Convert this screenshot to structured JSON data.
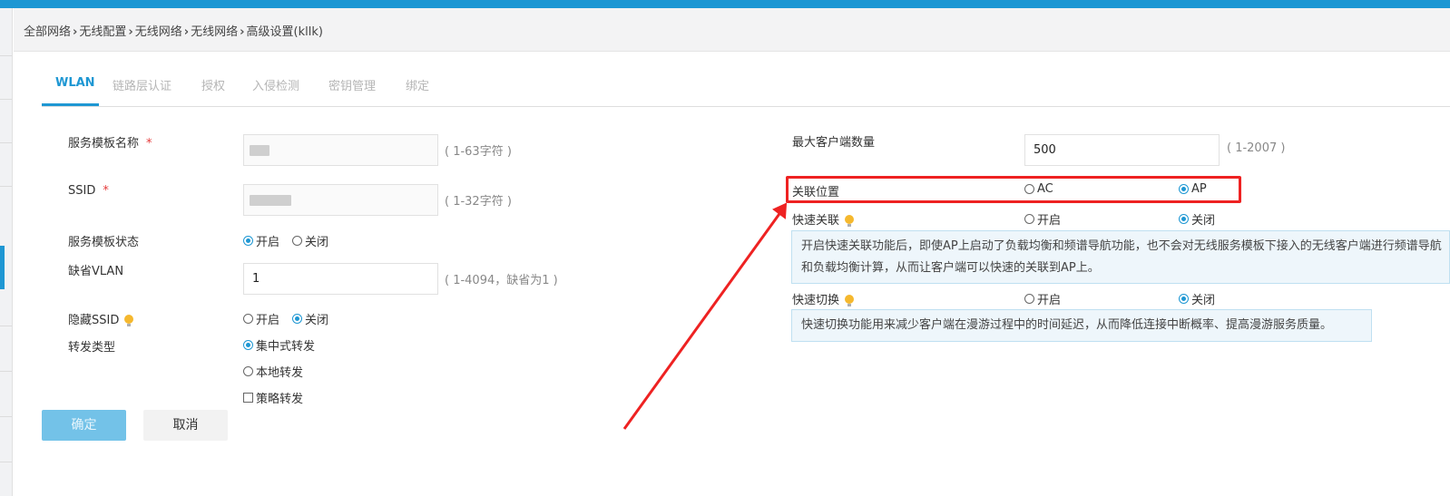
{
  "breadcrumb": [
    "全部网络",
    "无线配置",
    "无线网络",
    "无线网络",
    "高级设置(kllk)"
  ],
  "tabs": [
    "WLAN",
    "链路层认证",
    "授权",
    "入侵检测",
    "密钥管理",
    "绑定"
  ],
  "left": {
    "template_name": {
      "label": "服务模板名称",
      "required": "*",
      "hint": "( 1-63字符 )"
    },
    "ssid": {
      "label": "SSID",
      "required": "*",
      "hint": "( 1-32字符 )"
    },
    "template_status": {
      "label": "服务模板状态",
      "on": "开启",
      "off": "关闭",
      "selected": "开启"
    },
    "default_vlan": {
      "label": "缺省VLAN",
      "value": "1",
      "hint": "( 1-4094，缺省为1 )"
    },
    "hide_ssid": {
      "label": "隐藏SSID",
      "on": "开启",
      "off": "关闭",
      "selected": "关闭"
    },
    "forward_type": {
      "label": "转发类型",
      "options": [
        "集中式转发",
        "本地转发",
        "策略转发"
      ],
      "selected": "集中式转发"
    }
  },
  "right": {
    "max_clients": {
      "label": "最大客户端数量",
      "value": "500",
      "hint": "( 1-2007 )"
    },
    "assoc_location": {
      "label": "关联位置",
      "ac": "AC",
      "ap": "AP",
      "selected": "AP"
    },
    "fast_assoc": {
      "label": "快速关联",
      "on": "开启",
      "off": "关闭",
      "selected": "关闭",
      "info_line1": "开启快速关联功能后，即使AP上启动了负载均衡和频谱导航功能，也不会对无线服务模板下接入的无线客户端进行频谱导航",
      "info_line2": "和负载均衡计算，从而让客户端可以快速的关联到AP上。"
    },
    "fast_roam": {
      "label": "快速切换",
      "on": "开启",
      "off": "关闭",
      "selected": "关闭",
      "info": "快速切换功能用来减少客户端在漫游过程中的时间延迟，从而降低连接中断概率、提高漫游服务质量。"
    }
  },
  "buttons": {
    "ok": "确定",
    "cancel": "取消"
  },
  "colors": {
    "accent": "#1e97d3",
    "annotation": "#ee2222"
  }
}
